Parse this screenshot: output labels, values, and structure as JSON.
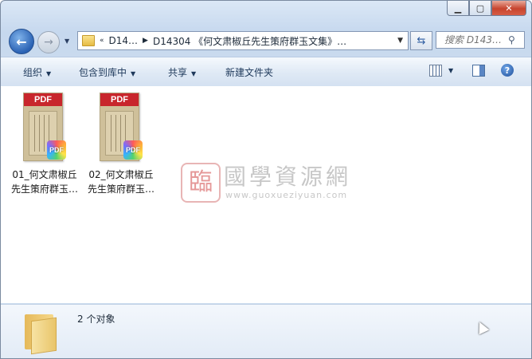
{
  "window": {
    "caption_buttons": [
      "minimize",
      "maximize",
      "close"
    ]
  },
  "nav": {
    "address_segments": [
      "D14…",
      "D14304 《何文肃椒丘先生策府群玉文集》…"
    ],
    "address_prefix": "«",
    "search_placeholder": "搜索 D143…"
  },
  "toolbar": {
    "organize": "组织",
    "include_library": "包含到库中",
    "share": "共享",
    "new_folder": "新建文件夹"
  },
  "files": [
    {
      "name_line1": "01_何文肃椒丘",
      "name_line2": "先生策府群玉…",
      "type": "PDF"
    },
    {
      "name_line1": "02_何文肃椒丘",
      "name_line2": "先生策府群玉…",
      "type": "PDF"
    }
  ],
  "watermark": {
    "seal": "臨",
    "title": "國學資源網",
    "url": "www.guoxueziyuan.com"
  },
  "details": {
    "count_text": "2 个对象"
  },
  "colors": {
    "pdf_band": "#c8262c",
    "window_frame": "#c6d8ee"
  }
}
